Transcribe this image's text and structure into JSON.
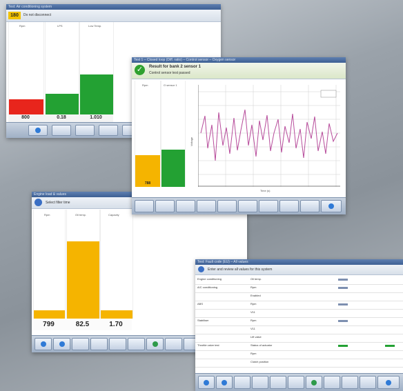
{
  "win1": {
    "title": "Test: Air conditioning system",
    "badge": "180",
    "subtitle": "Do not disconnect",
    "columns": [
      {
        "label": "Rpm",
        "value": "800"
      },
      {
        "label": "LPS",
        "value": "0.18"
      },
      {
        "label": "Low Temp.",
        "value": "1.010"
      }
    ],
    "colors": {
      "red": "#e8251c",
      "green": "#23a133"
    }
  },
  "win2": {
    "title": "Test 1 – Closed loop (Diff. ratio) – Control sensor – Oxygen sensor",
    "status_title": "Result for bank 2 sensor 1",
    "status_text": "Control sensor test passed",
    "columns": [
      {
        "label": "Rpm",
        "value": "788"
      },
      {
        "label": "O sensor 1",
        "value": ""
      }
    ],
    "xaxis_label": "Time (s)",
    "yaxis_label": "Voltage",
    "legend": "",
    "colors": {
      "yellow": "#f5b400",
      "green": "#23a133",
      "line": "#b64a9a"
    }
  },
  "win3": {
    "title": "Engine load & values",
    "hint": "Select filter time",
    "columns": [
      {
        "label": "Rpm",
        "value": "799"
      },
      {
        "label": "Oil temp.",
        "value": "82.5"
      },
      {
        "label": "Capacity",
        "value": "1.70"
      }
    ],
    "colors": {
      "yellow": "#f5b400"
    }
  },
  "win4": {
    "title": "Test: Fault code (EU) – All values",
    "hint": "Enter and review all values for this system",
    "rows": [
      {
        "group": "Engine conditioning",
        "name": "Oil temp."
      },
      {
        "group": "A/C conditioning",
        "name": "Rpm"
      },
      {
        "group": "",
        "name": "Enabled"
      },
      {
        "group": "ABS",
        "name": "Rpm"
      },
      {
        "group": "",
        "name": "V11"
      },
      {
        "group": "Stabiliser",
        "name": "Rpm"
      },
      {
        "group": "",
        "name": "V11"
      },
      {
        "group": "",
        "name": "Lift valve"
      },
      {
        "group": "Throttle valve test",
        "name": "Status of actuator"
      },
      {
        "group": "",
        "name": "Rpm"
      },
      {
        "group": "",
        "name": "Clutch position"
      }
    ],
    "colors": {
      "green": "#23a133"
    }
  }
}
